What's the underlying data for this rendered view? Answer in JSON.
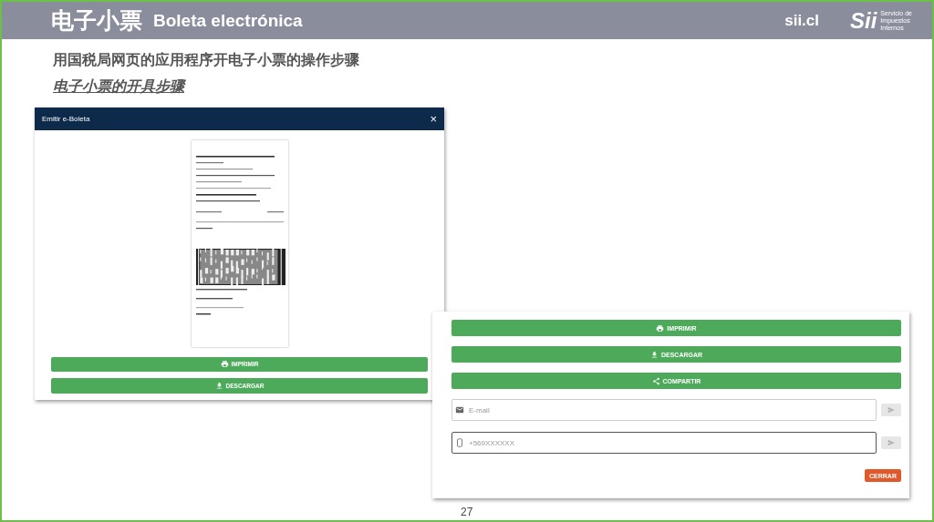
{
  "header": {
    "title_zh": "电子小票",
    "title_es": "Boleta electrónica",
    "site": "sii.cl",
    "logo_mark": "Sii",
    "logo_lines": [
      "Servicio de",
      "Impuestos",
      "Internos"
    ]
  },
  "subtitle": "用国税局网页的应用程序开电子小票的操作步骤",
  "heading": "电子小票的开具步骤",
  "modal": {
    "title": "Emitir e-Boleta",
    "close": "×",
    "buttons": [
      {
        "kind": "print",
        "label": "IMPRIMIR"
      },
      {
        "kind": "download",
        "label": "DESCARGAR"
      }
    ]
  },
  "panel": {
    "buttons": [
      {
        "kind": "print",
        "label": "IMPRIMIR"
      },
      {
        "kind": "download",
        "label": "DESCARGAR"
      },
      {
        "kind": "share",
        "label": "COMPARTIR"
      }
    ],
    "fields": [
      {
        "kind": "mail",
        "placeholder": "E-mail"
      },
      {
        "kind": "phone",
        "placeholder": "+569XXXXXX"
      }
    ],
    "close_button": "CERRAR"
  },
  "page_number": "27"
}
